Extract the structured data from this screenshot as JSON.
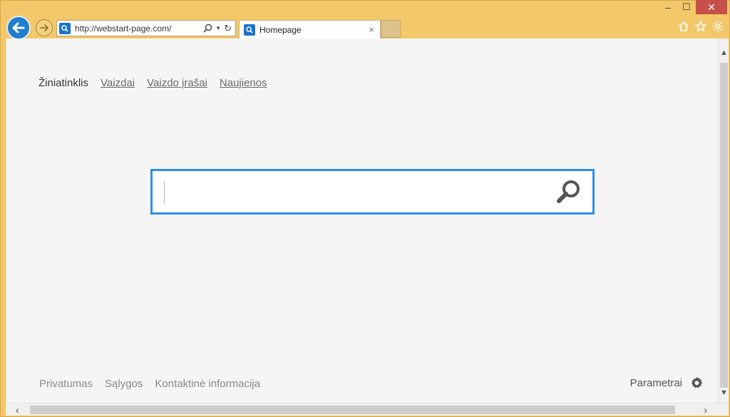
{
  "browser": {
    "address": {
      "url": "http://webstart-page.com/"
    },
    "tab": {
      "label": "Homepage",
      "close": "×"
    },
    "window_controls": {
      "minimize": "–",
      "maximize": "☐",
      "close": "✕"
    }
  },
  "page": {
    "topnav": {
      "active": "Žiniatinklis",
      "links": [
        "Vaizdai",
        "Vaizdo įrašai",
        "Naujienos"
      ]
    },
    "search": {
      "value": ""
    },
    "footer": {
      "links": [
        "Privatumas",
        "Sąlygos",
        "Kontaktinė informacija"
      ],
      "settings_label": "Parametrai"
    }
  },
  "colors": {
    "frame": "#f2c86a",
    "accent": "#2e8fe3",
    "back_button": "#1c7fcf",
    "close_button": "#c7504a"
  }
}
